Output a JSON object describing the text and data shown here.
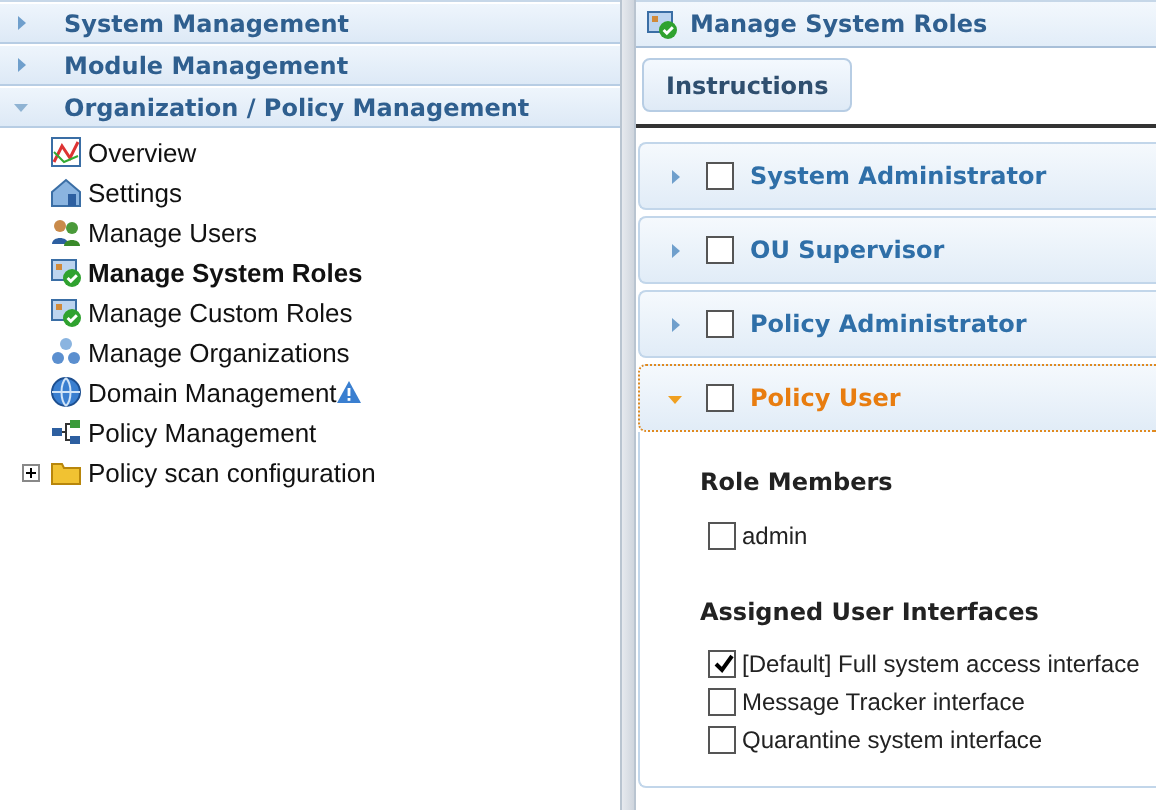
{
  "sections": [
    {
      "label": "System Management",
      "expanded": false
    },
    {
      "label": "Module Management",
      "expanded": false
    },
    {
      "label": "Organization / Policy Management",
      "expanded": true
    }
  ],
  "nav_items": [
    {
      "label": "Overview",
      "kind": "chart",
      "selected": false
    },
    {
      "label": "Settings",
      "kind": "house",
      "selected": false
    },
    {
      "label": "Manage Users",
      "kind": "users",
      "selected": false
    },
    {
      "label": "Manage System Roles",
      "kind": "roles",
      "selected": true
    },
    {
      "label": "Manage Custom Roles",
      "kind": "roles",
      "selected": false
    },
    {
      "label": "Manage Organizations",
      "kind": "org",
      "selected": false
    },
    {
      "label": "Domain Management",
      "kind": "globe",
      "selected": false,
      "warning": true
    },
    {
      "label": "Policy Management",
      "kind": "flow",
      "selected": false
    },
    {
      "label": "Policy scan configuration",
      "kind": "folder",
      "selected": false,
      "expanded": false
    }
  ],
  "panel": {
    "title": "Manage System Roles",
    "instructions_button": "Instructions",
    "roles": [
      {
        "name": "System Administrator",
        "checked": false,
        "expanded": false
      },
      {
        "name": "OU Supervisor",
        "checked": false,
        "expanded": false
      },
      {
        "name": "Policy Administrator",
        "checked": false,
        "expanded": false
      },
      {
        "name": "Policy User",
        "checked": false,
        "expanded": true
      }
    ],
    "role_members": {
      "heading": "Role Members",
      "members": [
        {
          "label": "admin",
          "checked": false
        }
      ]
    },
    "assigned_interfaces": {
      "heading": "Assigned User Interfaces",
      "items": [
        {
          "label": "[Default] Full system access interface",
          "checked": true
        },
        {
          "label": "Message Tracker interface",
          "checked": false
        },
        {
          "label": "Quarantine system interface",
          "checked": false
        }
      ]
    }
  }
}
